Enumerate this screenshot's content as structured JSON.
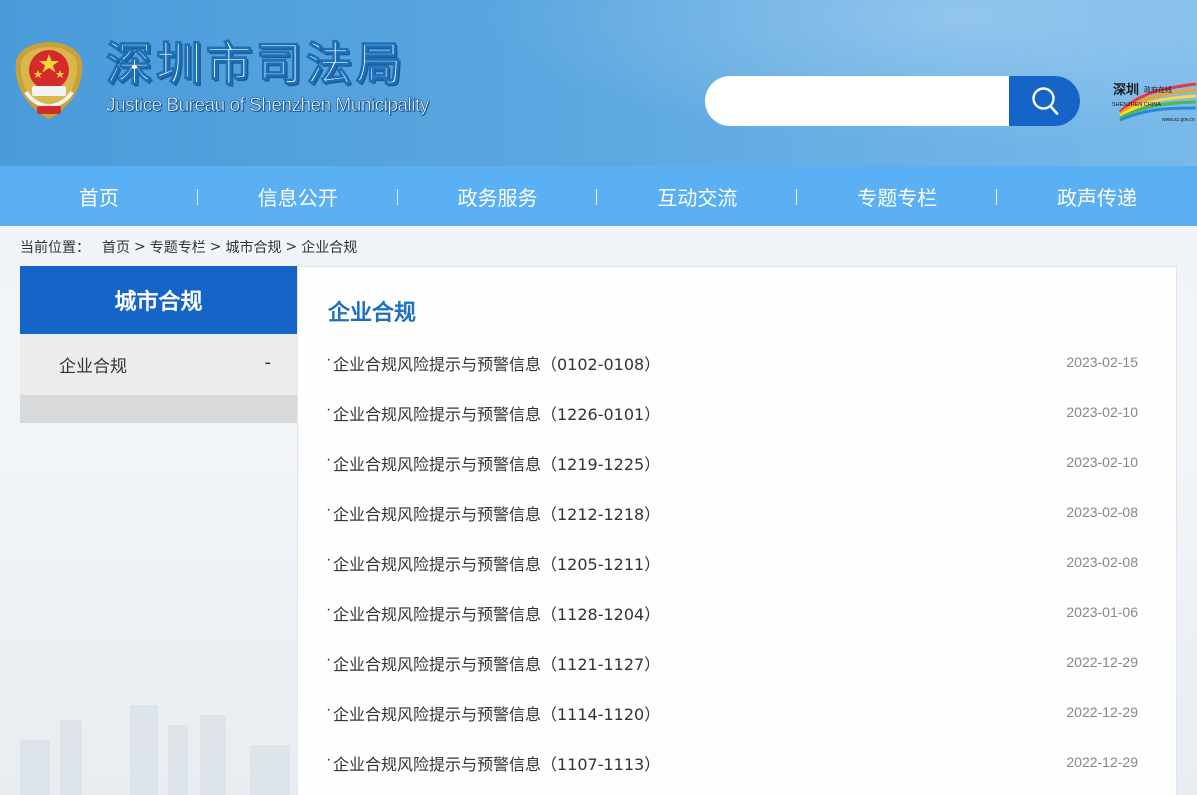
{
  "header": {
    "title": "深圳市司法局",
    "subtitle": "Justice Bureau of Shenzhen Municipality",
    "emblem_icon": "police-emblem-icon",
    "gov_logo": {
      "chars": "深圳",
      "text": "政府在线",
      "caption": "SHENZHEN CHINA",
      "url_text": "www.sz.gov.cn"
    },
    "search": {
      "value": "",
      "placeholder": "",
      "button_icon": "search-icon",
      "button_color": "#1565c8"
    }
  },
  "nav": {
    "items": [
      {
        "label": "首页"
      },
      {
        "label": "信息公开"
      },
      {
        "label": "政务服务"
      },
      {
        "label": "互动交流"
      },
      {
        "label": "专题专栏"
      },
      {
        "label": "政声传递"
      }
    ],
    "background_color": "#5ab0f2"
  },
  "breadcrumb": {
    "prefix": "当前位置：",
    "items": [
      {
        "label": "首页"
      },
      {
        "label": "专题专栏"
      },
      {
        "label": "城市合规"
      },
      {
        "label": "企业合规"
      }
    ],
    "separator": ">"
  },
  "sidebar": {
    "heading": "城市合规",
    "items": [
      {
        "label": "企业合规",
        "toggle": "-"
      }
    ],
    "accent_color": "#1565c8"
  },
  "main": {
    "title": "企业合规",
    "bullet": "·",
    "articles": [
      {
        "title": "企业合规风险提示与预警信息（0102-0108）",
        "date": "2023-02-15"
      },
      {
        "title": "企业合规风险提示与预警信息（1226-0101）",
        "date": "2023-02-10"
      },
      {
        "title": "企业合规风险提示与预警信息（1219-1225）",
        "date": "2023-02-10"
      },
      {
        "title": "企业合规风险提示与预警信息（1212-1218）",
        "date": "2023-02-08"
      },
      {
        "title": "企业合规风险提示与预警信息（1205-1211）",
        "date": "2023-02-08"
      },
      {
        "title": "企业合规风险提示与预警信息（1128-1204）",
        "date": "2023-01-06"
      },
      {
        "title": "企业合规风险提示与预警信息（1121-1127）",
        "date": "2022-12-29"
      },
      {
        "title": "企业合规风险提示与预警信息（1114-1120）",
        "date": "2022-12-29"
      },
      {
        "title": "企业合规风险提示与预警信息（1107-1113）",
        "date": "2022-12-29"
      }
    ]
  }
}
